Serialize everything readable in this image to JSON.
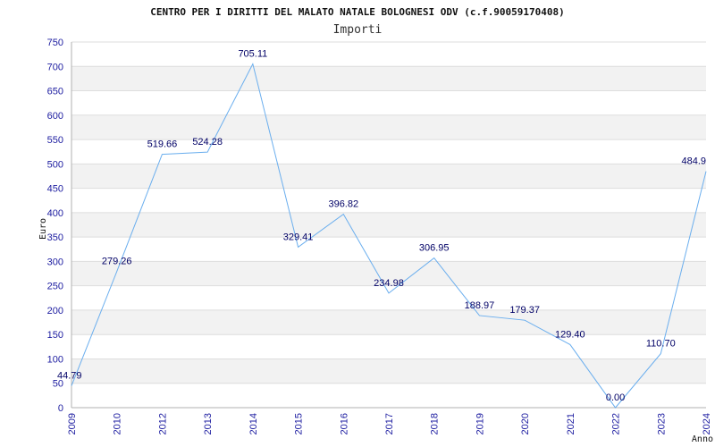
{
  "chart_data": {
    "type": "line",
    "title": "CENTRO PER I DIRITTI DEL MALATO NATALE BOLOGNESI ODV (c.f.90059170408)",
    "subtitle": "Importi",
    "xlabel": "Anno",
    "ylabel": "Euro",
    "x": [
      "2009",
      "2010",
      "2012",
      "2013",
      "2014",
      "2015",
      "2016",
      "2017",
      "2018",
      "2019",
      "2020",
      "2021",
      "2022",
      "2023",
      "2024"
    ],
    "values": [
      44.79,
      279.26,
      519.66,
      524.28,
      705.11,
      329.41,
      396.82,
      234.98,
      306.95,
      188.97,
      179.37,
      129.4,
      0.0,
      110.7,
      484.9
    ],
    "value_labels": [
      "44.79",
      "279.26",
      "519.66",
      "524.28",
      "705.11",
      "329.41",
      "396.82",
      "234.98",
      "306.95",
      "188.97",
      "179.37",
      "129.40",
      "0.00",
      "110.70",
      "484.9"
    ],
    "ylim": [
      0,
      750
    ],
    "yticks": [
      0,
      50,
      100,
      150,
      200,
      250,
      300,
      350,
      400,
      450,
      500,
      550,
      600,
      650,
      700,
      750
    ],
    "grid": true,
    "line_color": "#6aaeee",
    "band_color": "#f2f2f2"
  }
}
